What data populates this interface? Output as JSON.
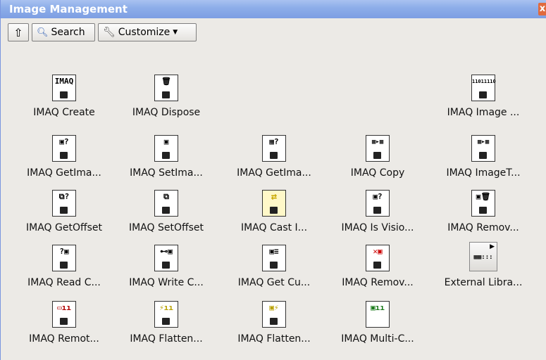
{
  "window": {
    "title": "Image Management",
    "close_label": "x"
  },
  "toolbar": {
    "up_icon": "arrow-up",
    "search_label": "Search",
    "customize_label": "Customize"
  },
  "items": [
    {
      "label": "IMAQ Create",
      "glyph": "IMAQ",
      "icon": "create-icon"
    },
    {
      "label": "IMAQ Dispose",
      "glyph": "🗑",
      "icon": "trash-icon"
    },
    {
      "label": "IMAQ Image ...",
      "glyph": "11011110",
      "icon": "image-to-array-icon"
    },
    {
      "label": "IMAQ GetIma...",
      "glyph": "▣?",
      "icon": "get-image-icon"
    },
    {
      "label": "IMAQ SetIma...",
      "glyph": "▣",
      "icon": "set-image-icon"
    },
    {
      "label": "IMAQ GetIma...",
      "glyph": "▦?",
      "icon": "get-image-info-icon"
    },
    {
      "label": "IMAQ Copy",
      "glyph": "▦▸▦",
      "icon": "copy-icon"
    },
    {
      "label": "IMAQ ImageT...",
      "glyph": "▦▸▦",
      "icon": "image-to-image-icon"
    },
    {
      "label": "IMAQ GetOffset",
      "glyph": "⧉?",
      "icon": "get-offset-icon"
    },
    {
      "label": "IMAQ SetOffset",
      "glyph": "⧉",
      "icon": "set-offset-icon"
    },
    {
      "label": "IMAQ Cast I...",
      "glyph": "⇄",
      "icon": "cast-image-icon"
    },
    {
      "label": "IMAQ Is Visio...",
      "glyph": "▣?",
      "icon": "is-vision-info-icon"
    },
    {
      "label": "IMAQ Remov...",
      "glyph": "▣🗑",
      "icon": "remove-icon"
    },
    {
      "label": "IMAQ Read C...",
      "glyph": "?▣",
      "icon": "read-custom-icon"
    },
    {
      "label": "IMAQ Write C...",
      "glyph": "⊷▣",
      "icon": "write-custom-icon"
    },
    {
      "label": "IMAQ Get Cu...",
      "glyph": "▣≡",
      "icon": "get-custom-keys-icon"
    },
    {
      "label": "IMAQ Remov...",
      "glyph": "✕▣",
      "icon": "remove-custom-icon"
    },
    {
      "label": "External Libra...",
      "glyph": "▦▦:::",
      "icon": "external-library-icon"
    },
    {
      "label": "IMAQ Remot...",
      "glyph": "▭ıı",
      "icon": "remote-icon"
    },
    {
      "label": "IMAQ Flatten...",
      "glyph": "⚡ıı",
      "icon": "flatten-icon"
    },
    {
      "label": "IMAQ Flatten...",
      "glyph": "▣⚡",
      "icon": "flatten-2-icon"
    },
    {
      "label": "IMAQ Multi-C...",
      "glyph": "▣ıı",
      "icon": "multi-core-icon"
    }
  ]
}
